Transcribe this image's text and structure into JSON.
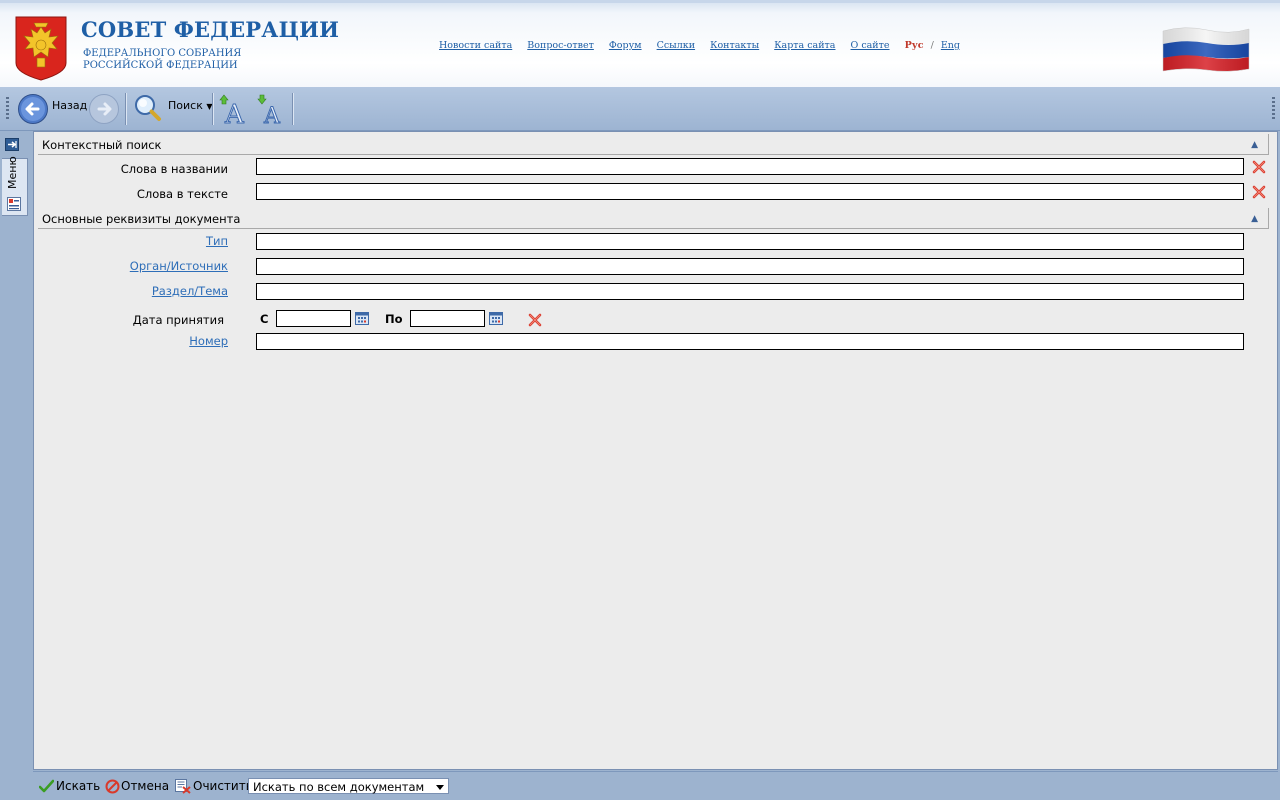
{
  "header": {
    "title": "СОВЕТ ФЕДЕРАЦИИ",
    "subtitle_line1": "ФЕДЕРАЛЬНОГО СОБРАНИЯ",
    "subtitle_line2": "РОССИЙСКОЙ ФЕДЕРАЦИИ",
    "nav": [
      "Новости сайта",
      "Вопрос-ответ",
      "Форум",
      "Ссылки",
      "Контакты",
      "Карта сайта",
      "О сайте"
    ],
    "lang_active": "Рус",
    "lang_sep": "/",
    "lang_other": "Eng"
  },
  "toolbar": {
    "back_label": "Назад",
    "search_label": "Поиск"
  },
  "sidebar": {
    "menu_label": "Меню"
  },
  "context_search": {
    "title": "Контекстный поиск",
    "collapse_icon": "collapse-up-icon",
    "fields": [
      {
        "label": "Слова в названии",
        "value": ""
      },
      {
        "label": "Слова в тексте",
        "value": ""
      }
    ]
  },
  "doc_details": {
    "title": "Основные реквизиты документа",
    "type_label": "Тип",
    "type_value": "",
    "source_label": "Орган/Источник",
    "source_value": "",
    "section_label": "Раздел/Тема",
    "section_value": "",
    "date_label": "Дата принятия",
    "date_from_label": "С",
    "date_from_value": "",
    "date_to_label": "По",
    "date_to_value": "",
    "number_label": "Номер",
    "number_value": ""
  },
  "bottom": {
    "search_label": "Искать",
    "cancel_label": "Отмена",
    "clear_label": "Очистить",
    "scope_value": "Искать по всем документам"
  },
  "colors": {
    "brand_blue": "#1f5fa6",
    "toolbar_bg": "#9db3cf",
    "panel_bg": "#ececec",
    "link": "#2e6eb8",
    "clear_red": "#d9392b"
  }
}
